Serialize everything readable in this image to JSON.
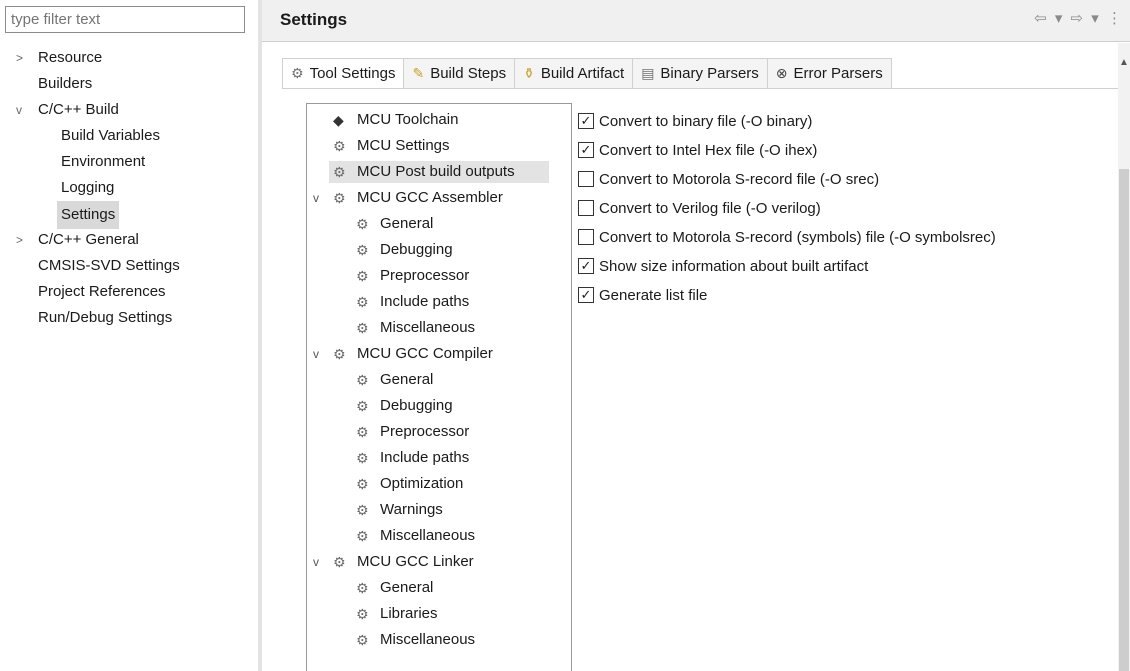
{
  "filter": {
    "placeholder": "type filter text"
  },
  "nav": {
    "items": [
      {
        "label": "Resource",
        "twisty": ">"
      },
      {
        "label": "Builders",
        "twisty": ""
      },
      {
        "label": "C/C++ Build",
        "twisty": "v"
      },
      {
        "label": "Build Variables",
        "twisty": ""
      },
      {
        "label": "Environment",
        "twisty": ""
      },
      {
        "label": "Logging",
        "twisty": ""
      },
      {
        "label": "Settings",
        "twisty": ""
      },
      {
        "label": "C/C++ General",
        "twisty": ">"
      },
      {
        "label": "CMSIS-SVD Settings",
        "twisty": ""
      },
      {
        "label": "Project References",
        "twisty": ""
      },
      {
        "label": "Run/Debug Settings",
        "twisty": ""
      }
    ]
  },
  "header": {
    "title": "Settings",
    "nav_buttons": "⇦ ▾ ⇨ ▾ ⋮"
  },
  "tabs": [
    {
      "label": "Tool Settings",
      "icon": "gear-icon",
      "glyph": "⚙"
    },
    {
      "label": "Build Steps",
      "icon": "steps-icon",
      "glyph": "✎"
    },
    {
      "label": "Build Artifact",
      "icon": "artifact-icon",
      "glyph": "⚱"
    },
    {
      "label": "Binary Parsers",
      "icon": "binary-icon",
      "glyph": "▤"
    },
    {
      "label": "Error Parsers",
      "icon": "error-icon",
      "glyph": "⊗"
    }
  ],
  "tree": {
    "items": [
      {
        "label": "MCU Toolchain",
        "icon": "toolchain-icon",
        "glyph": "◆",
        "expander": ""
      },
      {
        "label": "MCU Settings",
        "icon": "settings-icon",
        "glyph": "⚙",
        "expander": ""
      },
      {
        "label": "MCU Post build outputs",
        "icon": "settings-icon",
        "glyph": "⚙",
        "expander": ""
      },
      {
        "label": "MCU GCC Assembler",
        "icon": "tool-icon",
        "glyph": "⚙",
        "expander": "v"
      },
      {
        "label": "General",
        "icon": "settings-icon",
        "glyph": "⚙",
        "expander": ""
      },
      {
        "label": "Debugging",
        "icon": "settings-icon",
        "glyph": "⚙",
        "expander": ""
      },
      {
        "label": "Preprocessor",
        "icon": "settings-icon",
        "glyph": "⚙",
        "expander": ""
      },
      {
        "label": "Include paths",
        "icon": "settings-icon",
        "glyph": "⚙",
        "expander": ""
      },
      {
        "label": "Miscellaneous",
        "icon": "settings-icon",
        "glyph": "⚙",
        "expander": ""
      },
      {
        "label": "MCU GCC Compiler",
        "icon": "tool-icon",
        "glyph": "⚙",
        "expander": "v"
      },
      {
        "label": "General",
        "icon": "settings-icon",
        "glyph": "⚙",
        "expander": ""
      },
      {
        "label": "Debugging",
        "icon": "settings-icon",
        "glyph": "⚙",
        "expander": ""
      },
      {
        "label": "Preprocessor",
        "icon": "settings-icon",
        "glyph": "⚙",
        "expander": ""
      },
      {
        "label": "Include paths",
        "icon": "settings-icon",
        "glyph": "⚙",
        "expander": ""
      },
      {
        "label": "Optimization",
        "icon": "settings-icon",
        "glyph": "⚙",
        "expander": ""
      },
      {
        "label": "Warnings",
        "icon": "settings-icon",
        "glyph": "⚙",
        "expander": ""
      },
      {
        "label": "Miscellaneous",
        "icon": "settings-icon",
        "glyph": "⚙",
        "expander": ""
      },
      {
        "label": "MCU GCC Linker",
        "icon": "tool-icon",
        "glyph": "⚙",
        "expander": "v"
      },
      {
        "label": "General",
        "icon": "settings-icon",
        "glyph": "⚙",
        "expander": ""
      },
      {
        "label": "Libraries",
        "icon": "settings-icon",
        "glyph": "⚙",
        "expander": ""
      },
      {
        "label": "Miscellaneous",
        "icon": "settings-icon",
        "glyph": "⚙",
        "expander": ""
      }
    ]
  },
  "options": [
    {
      "label": "Convert to binary file (-O binary)",
      "checked": true
    },
    {
      "label": "Convert to Intel Hex file (-O ihex)",
      "checked": true
    },
    {
      "label": "Convert to Motorola S-record file (-O srec)",
      "checked": false
    },
    {
      "label": "Convert to Verilog file (-O verilog)",
      "checked": false
    },
    {
      "label": "Convert to Motorola S-record (symbols) file (-O symbolsrec)",
      "checked": false
    },
    {
      "label": "Show size information about built artifact",
      "checked": true
    },
    {
      "label": "Generate list file",
      "checked": true
    }
  ],
  "check_glyph": "✓"
}
